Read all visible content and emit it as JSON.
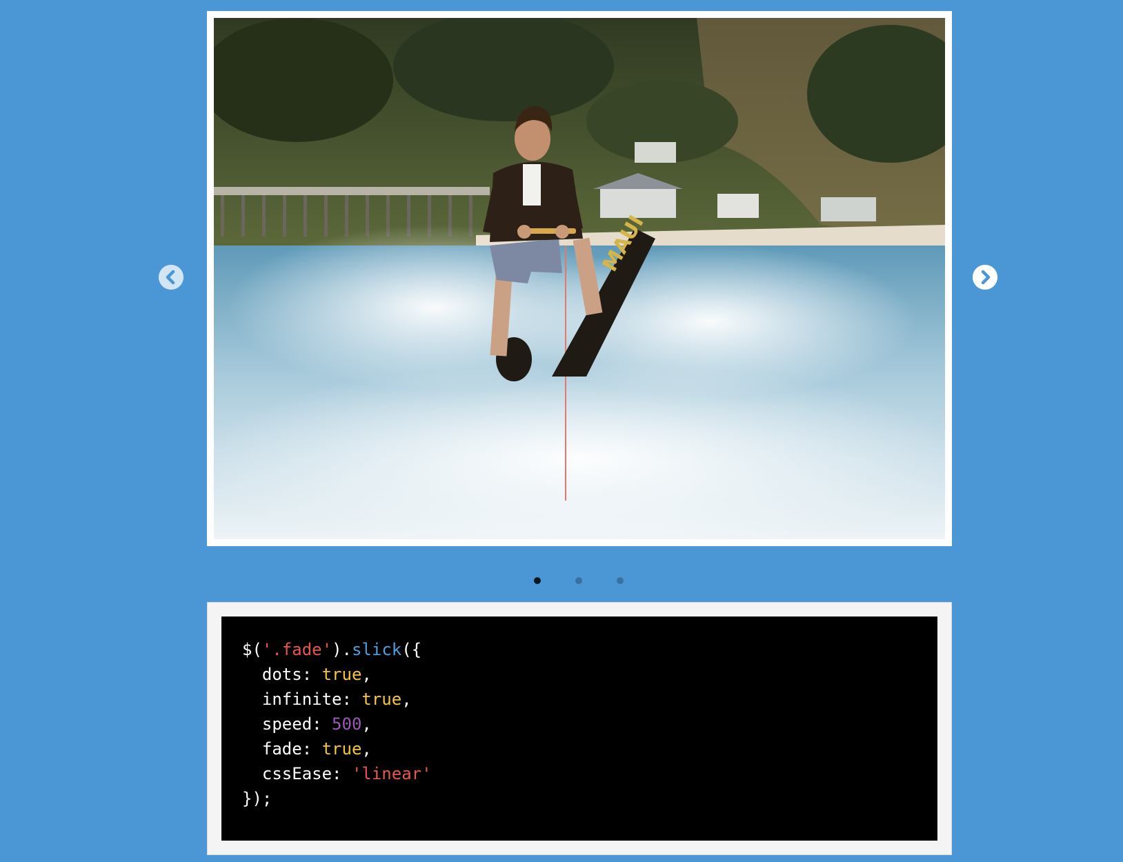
{
  "slider": {
    "image_alt": "Man water skiing on one ski wearing a leather jacket near a pier and beach",
    "prev_icon": "chevron-left-circle-icon",
    "next_icon": "chevron-right-circle-icon",
    "slide_count": 3,
    "active_slide": 1
  },
  "code": {
    "line1": {
      "a": "$(",
      "b": "'.fade'",
      "c": ").",
      "d": "slick",
      "e": "({"
    },
    "line2": {
      "key": "  dots: ",
      "val": "true",
      "end": ","
    },
    "line3": {
      "key": "  infinite: ",
      "val": "true",
      "end": ","
    },
    "line4": {
      "key": "  speed: ",
      "val": "500",
      "end": ","
    },
    "line5": {
      "key": "  fade: ",
      "val": "true",
      "end": ","
    },
    "line6": {
      "key": "  cssEase: ",
      "val": "'linear'"
    },
    "line7": "});"
  },
  "colors": {
    "background": "#4b97d6",
    "string": "#e8574b",
    "function": "#4a9fe0",
    "boolean": "#f5c542",
    "number": "#9b59b6"
  }
}
